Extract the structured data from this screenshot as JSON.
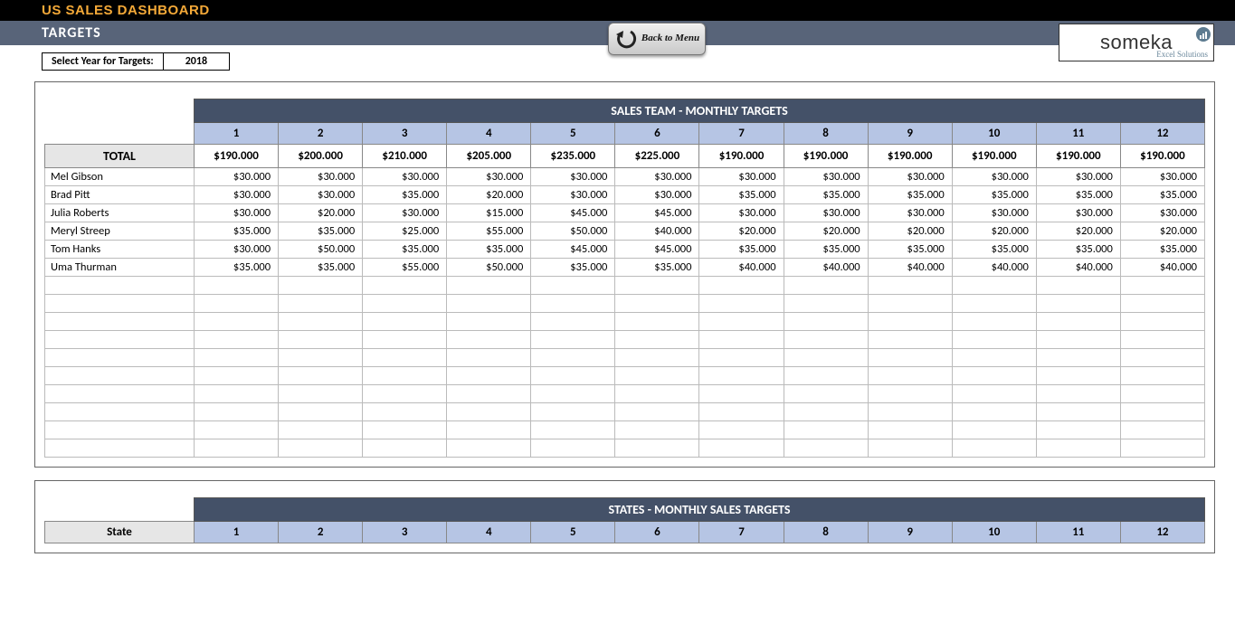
{
  "header": {
    "title": "US SALES DASHBOARD",
    "subtitle": "TARGETS",
    "back_button": "Back to Menu",
    "logo_name": "someka",
    "logo_tag": "Excel Solutions"
  },
  "year_select": {
    "label": "Select Year for Targets:",
    "value": "2018"
  },
  "sales_team": {
    "heading": "SALES TEAM - MONTHLY TARGETS",
    "months": [
      "1",
      "2",
      "3",
      "4",
      "5",
      "6",
      "7",
      "8",
      "9",
      "10",
      "11",
      "12"
    ],
    "total_label": "TOTAL",
    "totals": [
      "$190.000",
      "$200.000",
      "$210.000",
      "$205.000",
      "$235.000",
      "$225.000",
      "$190.000",
      "$190.000",
      "$190.000",
      "$190.000",
      "$190.000",
      "$190.000"
    ],
    "rows": [
      {
        "name": "Mel Gibson",
        "vals": [
          "$30.000",
          "$30.000",
          "$30.000",
          "$30.000",
          "$30.000",
          "$30.000",
          "$30.000",
          "$30.000",
          "$30.000",
          "$30.000",
          "$30.000",
          "$30.000"
        ]
      },
      {
        "name": "Brad Pitt",
        "vals": [
          "$30.000",
          "$30.000",
          "$35.000",
          "$20.000",
          "$30.000",
          "$30.000",
          "$35.000",
          "$35.000",
          "$35.000",
          "$35.000",
          "$35.000",
          "$35.000"
        ]
      },
      {
        "name": "Julia Roberts",
        "vals": [
          "$30.000",
          "$20.000",
          "$30.000",
          "$15.000",
          "$45.000",
          "$45.000",
          "$30.000",
          "$30.000",
          "$30.000",
          "$30.000",
          "$30.000",
          "$30.000"
        ]
      },
      {
        "name": "Meryl Streep",
        "vals": [
          "$35.000",
          "$35.000",
          "$25.000",
          "$55.000",
          "$50.000",
          "$40.000",
          "$20.000",
          "$20.000",
          "$20.000",
          "$20.000",
          "$20.000",
          "$20.000"
        ]
      },
      {
        "name": "Tom Hanks",
        "vals": [
          "$30.000",
          "$50.000",
          "$35.000",
          "$35.000",
          "$45.000",
          "$45.000",
          "$35.000",
          "$35.000",
          "$35.000",
          "$35.000",
          "$35.000",
          "$35.000"
        ]
      },
      {
        "name": "Uma Thurman",
        "vals": [
          "$35.000",
          "$35.000",
          "$55.000",
          "$50.000",
          "$35.000",
          "$35.000",
          "$40.000",
          "$40.000",
          "$40.000",
          "$40.000",
          "$40.000",
          "$40.000"
        ]
      }
    ],
    "empty_rows": 10
  },
  "states": {
    "heading": "STATES - MONTHLY SALES TARGETS",
    "name_label": "State",
    "months": [
      "1",
      "2",
      "3",
      "4",
      "5",
      "6",
      "7",
      "8",
      "9",
      "10",
      "11",
      "12"
    ]
  }
}
